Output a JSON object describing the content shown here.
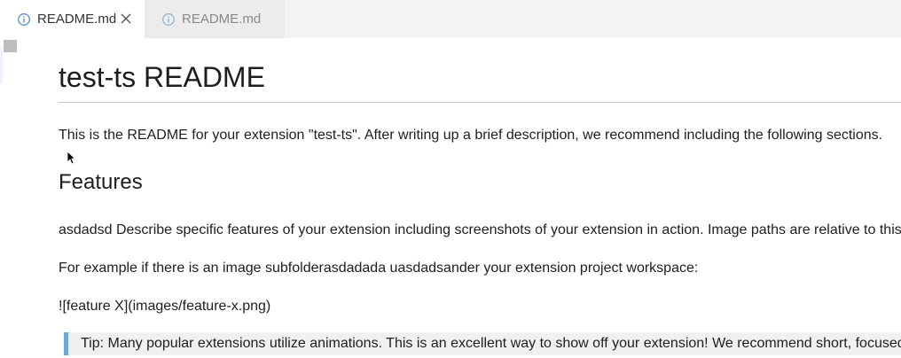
{
  "tabs": [
    {
      "label": "README.md",
      "active": true,
      "icon": "info-icon",
      "closable": true
    },
    {
      "label": "README.md",
      "active": false,
      "icon": "info-icon",
      "closable": false
    }
  ],
  "document": {
    "title": "test-ts README",
    "intro": "This is the README for your extension \"test-ts\". After writing up a brief description, we recommend including the following sections.",
    "features_heading": "Features",
    "features_text": "asdadsd Describe specific features of your extension including screenshots of your extension in action. Image paths are relative to this",
    "example_text": "For example if there is an image subfolderasdadada uasdadsander your extension project workspace:",
    "image_markdown": "![feature X](images/feature-x.png)",
    "tip_text": "Tip: Many popular extensions utilize animations. This is an excellent way to show off your extension! We recommend short, focused"
  },
  "colors": {
    "tabbar_bg": "#f3f3f3",
    "active_tab_bg": "#ffffff",
    "inactive_tab_bg": "#ececec",
    "info_icon": "#5a8fc4",
    "tip_border": "#6fa8dc"
  }
}
